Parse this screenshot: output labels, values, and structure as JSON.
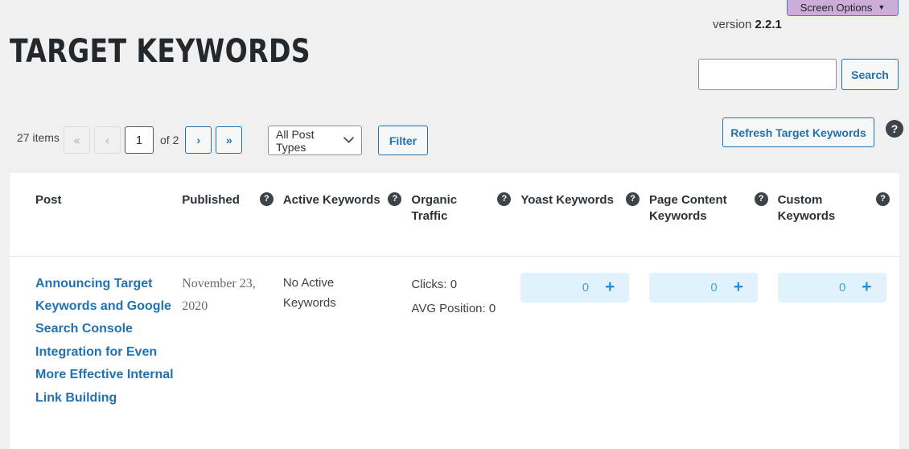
{
  "screen_options": {
    "label": "Screen Options",
    "caret": "▼",
    "bg": "#ccadd8",
    "border": "#2e88c4"
  },
  "header": {
    "title": "TARGET KEYWORDS",
    "version_label": "version",
    "version_number": "2.2.1"
  },
  "search": {
    "value": "",
    "placeholder": "",
    "button_label": "Search"
  },
  "toolbar": {
    "items_count": "27 items",
    "pager": {
      "first_label": "«",
      "prev_label": "‹",
      "current_page": "1",
      "of_label": "of 2",
      "next_label": "›",
      "last_label": "»"
    },
    "post_type_select": {
      "value": "All Post Types",
      "chevron": "⌄"
    },
    "filter_label": "Filter",
    "refresh_label": "Refresh Target Keywords",
    "help_glyph": "?"
  },
  "table": {
    "columns": [
      {
        "label": "Post",
        "help": false
      },
      {
        "label": "Published",
        "help": true,
        "help_glyph": "?"
      },
      {
        "label": "Active\nKeywords",
        "help": true,
        "help_glyph": "?"
      },
      {
        "label": "Organic\nTraffic",
        "help": true,
        "help_glyph": "?"
      },
      {
        "label": "Yoast\nKeywords",
        "help": true,
        "help_glyph": "?"
      },
      {
        "label": "Page Content\nKeywords",
        "help": true,
        "help_glyph": "?"
      },
      {
        "label": "Custom\nKeywords",
        "help": true,
        "help_glyph": "?"
      }
    ],
    "rows": [
      {
        "post_title": "Announcing Target Keywords and Google Search Console Integration for Even More Effective Internal Link Building",
        "published": "November 23, 2020",
        "active_keywords": "No Active Keywords",
        "organic_clicks": "Clicks: 0",
        "organic_avg_position": "AVG Position: 0",
        "yoast_keywords_count": "0",
        "page_content_keywords_count": "0",
        "custom_keywords_count": "0",
        "add_glyph": "+"
      }
    ]
  },
  "colors": {
    "page_bg": "#f0f0f1",
    "accent_blue": "#2271b1",
    "link_blue": "#2271b1",
    "counter_bg": "#e2f2fc",
    "counter_text": "#3da5e8"
  }
}
